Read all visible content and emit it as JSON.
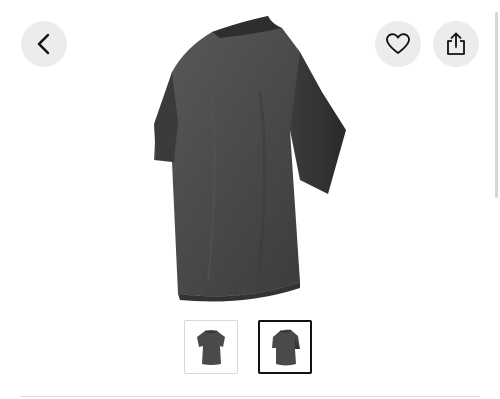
{
  "product": {
    "image": {
      "subject": "tshirt-icon",
      "color": "#4a4a4a"
    },
    "selected_thumbnail": 2
  },
  "header": {
    "back_icon": "chevron-left-icon",
    "favorite_icon": "heart-icon",
    "share_icon": "share-icon"
  },
  "gallery": {
    "thumbnails": [
      {
        "icon": "tshirt-icon",
        "selected": false
      },
      {
        "icon": "tshirt-icon",
        "selected": true
      }
    ]
  },
  "colors": {
    "button_bg": "#ececec",
    "garment": "#4a4a4a",
    "selected_border": "#111111"
  }
}
